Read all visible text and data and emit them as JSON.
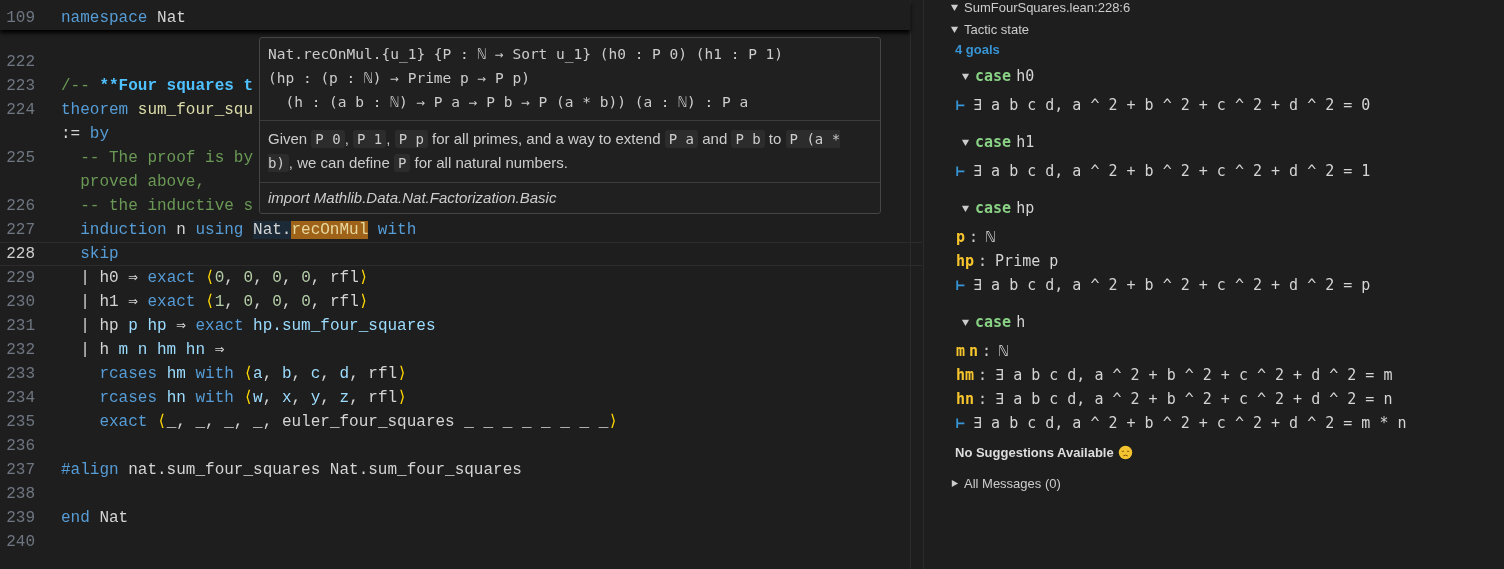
{
  "editor": {
    "sticky_line": {
      "number": "109",
      "tokens": [
        {
          "text": "namespace",
          "kind": "kw"
        },
        {
          "text": " Nat",
          "kind": "plain"
        }
      ]
    },
    "lines": [
      {
        "number": "222",
        "current": false
      },
      {
        "number": "223",
        "current": false,
        "tokens": [
          {
            "text": "/-- ",
            "kind": "com"
          },
          {
            "text": "**Four squares t",
            "kind": "docbold"
          }
        ]
      },
      {
        "number": "224",
        "current": false,
        "tokens": [
          {
            "text": "theorem ",
            "kind": "kw"
          },
          {
            "text": "sum_four_squ",
            "kind": "fn"
          }
        ],
        "continuation": [
          {
            "text": ":= ",
            "kind": "plain"
          },
          {
            "text": "by",
            "kind": "kw"
          }
        ]
      },
      {
        "number": "225",
        "current": false,
        "tokens": [
          {
            "text": "  -- The proof is by",
            "kind": "com"
          }
        ],
        "continuation": [
          {
            "text": "  proved above,",
            "kind": "com"
          }
        ]
      },
      {
        "number": "226",
        "current": false,
        "tokens": [
          {
            "text": "  -- the inductive s",
            "kind": "com"
          }
        ]
      },
      {
        "number": "227",
        "current": false,
        "tokens": [
          {
            "text": "  induction",
            "kind": "kw"
          },
          {
            "text": " n ",
            "kind": "plain"
          },
          {
            "text": "using ",
            "kind": "kw"
          },
          {
            "text": "Nat.",
            "kind": "ref"
          },
          {
            "text": "recOnMul",
            "kind": "match"
          },
          {
            "text": " with",
            "kind": "kw"
          }
        ]
      },
      {
        "number": "228",
        "current": true,
        "tokens": [
          {
            "text": "  skip",
            "kind": "kw"
          }
        ]
      },
      {
        "number": "229",
        "current": false,
        "tokens": [
          {
            "text": "  | h0 ⇒ ",
            "kind": "plain"
          },
          {
            "text": "exact ",
            "kind": "kw"
          },
          {
            "text": "⟨",
            "kind": "br"
          },
          {
            "text": "0",
            "kind": "num"
          },
          {
            "text": ", ",
            "kind": "plain"
          },
          {
            "text": "0",
            "kind": "num"
          },
          {
            "text": ", ",
            "kind": "plain"
          },
          {
            "text": "0",
            "kind": "num"
          },
          {
            "text": ", ",
            "kind": "plain"
          },
          {
            "text": "0",
            "kind": "num"
          },
          {
            "text": ", rfl",
            "kind": "plain"
          },
          {
            "text": "⟩",
            "kind": "br"
          }
        ]
      },
      {
        "number": "230",
        "current": false,
        "tokens": [
          {
            "text": "  | h1 ⇒ ",
            "kind": "plain"
          },
          {
            "text": "exact ",
            "kind": "kw"
          },
          {
            "text": "⟨",
            "kind": "br"
          },
          {
            "text": "1",
            "kind": "num"
          },
          {
            "text": ", ",
            "kind": "plain"
          },
          {
            "text": "0",
            "kind": "num"
          },
          {
            "text": ", ",
            "kind": "plain"
          },
          {
            "text": "0",
            "kind": "num"
          },
          {
            "text": ", ",
            "kind": "plain"
          },
          {
            "text": "0",
            "kind": "num"
          },
          {
            "text": ", rfl",
            "kind": "plain"
          },
          {
            "text": "⟩",
            "kind": "br"
          }
        ]
      },
      {
        "number": "231",
        "current": false,
        "tokens": [
          {
            "text": "  | hp ",
            "kind": "plain"
          },
          {
            "text": "p hp",
            "kind": "var"
          },
          {
            "text": " ⇒ ",
            "kind": "plain"
          },
          {
            "text": "exact ",
            "kind": "kw"
          },
          {
            "text": "hp.sum_four_squares",
            "kind": "var"
          }
        ]
      },
      {
        "number": "232",
        "current": false,
        "tokens": [
          {
            "text": "  | h ",
            "kind": "plain"
          },
          {
            "text": "m n hm hn",
            "kind": "var"
          },
          {
            "text": " ⇒",
            "kind": "plain"
          }
        ]
      },
      {
        "number": "233",
        "current": false,
        "tokens": [
          {
            "text": "    rcases ",
            "kind": "kw"
          },
          {
            "text": "hm ",
            "kind": "var"
          },
          {
            "text": "with ",
            "kind": "kw"
          },
          {
            "text": "⟨",
            "kind": "br"
          },
          {
            "text": "a",
            "kind": "var"
          },
          {
            "text": ", ",
            "kind": "plain"
          },
          {
            "text": "b",
            "kind": "var"
          },
          {
            "text": ", ",
            "kind": "plain"
          },
          {
            "text": "c",
            "kind": "var"
          },
          {
            "text": ", ",
            "kind": "plain"
          },
          {
            "text": "d",
            "kind": "var"
          },
          {
            "text": ", rfl",
            "kind": "plain"
          },
          {
            "text": "⟩",
            "kind": "br"
          }
        ]
      },
      {
        "number": "234",
        "current": false,
        "tokens": [
          {
            "text": "    rcases ",
            "kind": "kw"
          },
          {
            "text": "hn ",
            "kind": "var"
          },
          {
            "text": "with ",
            "kind": "kw"
          },
          {
            "text": "⟨",
            "kind": "br"
          },
          {
            "text": "w",
            "kind": "var"
          },
          {
            "text": ", ",
            "kind": "plain"
          },
          {
            "text": "x",
            "kind": "var"
          },
          {
            "text": ", ",
            "kind": "plain"
          },
          {
            "text": "y",
            "kind": "var"
          },
          {
            "text": ", ",
            "kind": "plain"
          },
          {
            "text": "z",
            "kind": "var"
          },
          {
            "text": ", rfl",
            "kind": "plain"
          },
          {
            "text": "⟩",
            "kind": "br"
          }
        ]
      },
      {
        "number": "235",
        "current": false,
        "tokens": [
          {
            "text": "    exact ",
            "kind": "kw"
          },
          {
            "text": "⟨",
            "kind": "br"
          },
          {
            "text": "_, _, _, _, euler_four_squares _ _ _ _ _ _ _ _",
            "kind": "plain"
          },
          {
            "text": "⟩",
            "kind": "br"
          }
        ]
      },
      {
        "number": "236",
        "current": false
      },
      {
        "number": "237",
        "current": false,
        "tokens": [
          {
            "text": "#align",
            "kind": "kw"
          },
          {
            "text": " nat.sum_four_squares Nat.sum_four_squares",
            "kind": "plain"
          }
        ]
      },
      {
        "number": "238",
        "current": false
      },
      {
        "number": "239",
        "current": false,
        "tokens": [
          {
            "text": "end",
            "kind": "kw"
          },
          {
            "text": " Nat",
            "kind": "plain"
          }
        ]
      },
      {
        "number": "240",
        "current": false
      }
    ]
  },
  "hover": {
    "signature": [
      "Nat.recOnMul.{u_1} {P : ℕ → Sort u_1} (h0 : P 0) (h1 : P 1)",
      "(hp : (p : ℕ) → Prime p → P p)",
      "  (h : (a b : ℕ) → P a → P b → P (a * b)) (a : ℕ) : P a"
    ],
    "doc": [
      {
        "text": "Given ",
        "kind": "text"
      },
      {
        "text": "P 0",
        "kind": "code"
      },
      {
        "text": ", ",
        "kind": "text"
      },
      {
        "text": "P 1",
        "kind": "code"
      },
      {
        "text": ", ",
        "kind": "text"
      },
      {
        "text": "P p",
        "kind": "code"
      },
      {
        "text": " for all primes, and a way to extend ",
        "kind": "text"
      },
      {
        "text": "P a",
        "kind": "code"
      },
      {
        "text": " and ",
        "kind": "text"
      },
      {
        "text": "P b",
        "kind": "code"
      },
      {
        "text": " to ",
        "kind": "text"
      },
      {
        "text": "P (a * b)",
        "kind": "code"
      },
      {
        "text": ", we can define ",
        "kind": "text"
      },
      {
        "text": "P",
        "kind": "code"
      },
      {
        "text": " for all natural numbers.",
        "kind": "text"
      }
    ],
    "import": "import Mathlib.Data.Nat.Factorization.Basic"
  },
  "infoview": {
    "location": {
      "label": "SumFourSquares.lean:228:6",
      "expanded": true
    },
    "tactic_state": {
      "label": "Tactic state",
      "expanded": true
    },
    "goal_count": "4 goals",
    "goals": [
      {
        "keyword": "case",
        "name": "h0",
        "expanded": true,
        "turnstile": "⊢",
        "goal": "∃ a b c d, a ^ 2 + b ^ 2 + c ^ 2 + d ^ 2 = 0"
      },
      {
        "keyword": "case",
        "name": "h1",
        "expanded": true,
        "turnstile": "⊢",
        "goal": "∃ a b c d, a ^ 2 + b ^ 2 + c ^ 2 + d ^ 2 = 1"
      },
      {
        "keyword": "case",
        "name": "hp",
        "expanded": true,
        "hyps": [
          {
            "names": [
              "p"
            ],
            "separator": ":",
            "type": "ℕ"
          },
          {
            "names": [
              "hp"
            ],
            "separator": ":",
            "type": "Prime p"
          }
        ],
        "turnstile": "⊢",
        "goal": "∃ a b c d, a ^ 2 + b ^ 2 + c ^ 2 + d ^ 2 = p"
      },
      {
        "keyword": "case",
        "name": "h",
        "expanded": true,
        "hyps": [
          {
            "names": [
              "m",
              "n"
            ],
            "separator": ":",
            "type": "ℕ"
          },
          {
            "names": [
              "hm"
            ],
            "separator": ":",
            "type": "∃ a b c d, a ^ 2 + b ^ 2 + c ^ 2 + d ^ 2 = m"
          },
          {
            "names": [
              "hn"
            ],
            "separator": ":",
            "type": "∃ a b c d, a ^ 2 + b ^ 2 + c ^ 2 + d ^ 2 = n"
          }
        ],
        "turnstile": "⊢",
        "goal": "∃ a b c d, a ^ 2 + b ^ 2 + c ^ 2 + d ^ 2 = m * n"
      }
    ],
    "suggestions": "No Suggestions Available",
    "messages": {
      "label": "All Messages (0)",
      "expanded": false
    }
  }
}
